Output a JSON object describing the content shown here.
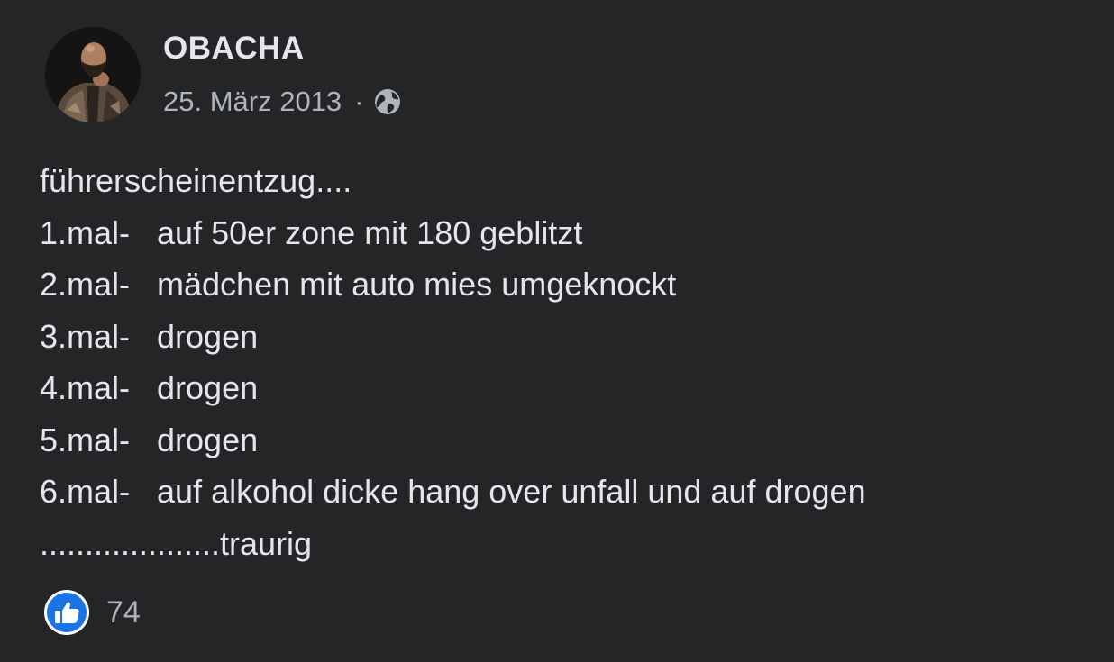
{
  "post": {
    "author": "OBACHA",
    "date": "25. März 2013",
    "separator": "·",
    "audience_icon": "globe-icon",
    "lines": [
      "führerscheinentzug....",
      "1.mal-   auf 50er zone mit 180 geblitzt",
      "2.mal-   mädchen mit auto mies umgeknockt",
      "3.mal-   drogen",
      "4.mal-   drogen",
      "5.mal-   drogen",
      "6.mal-   auf alkohol dicke hang over unfall und auf drogen",
      "....................traurig"
    ],
    "reactions": {
      "icon": "like-icon",
      "count": "74"
    }
  },
  "colors": {
    "background": "#242526",
    "text_primary": "#e4e6eb",
    "text_secondary": "#b0b3b8",
    "like_blue": "#1b74e4"
  }
}
